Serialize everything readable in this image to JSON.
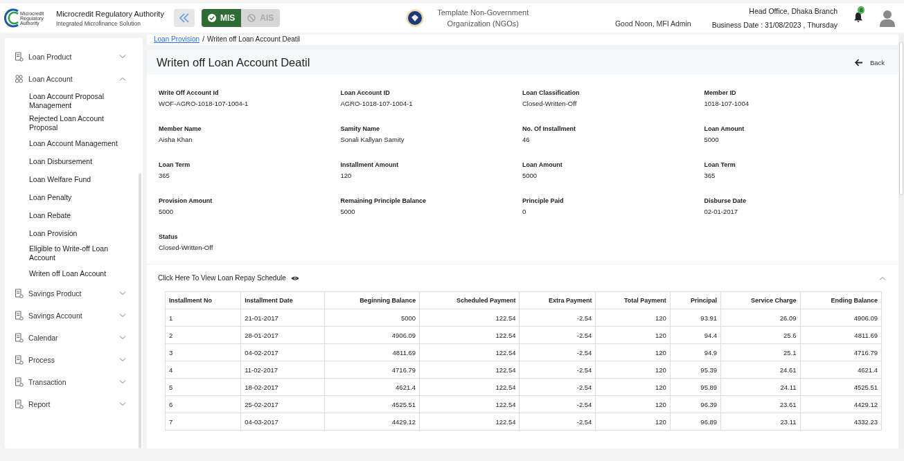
{
  "header": {
    "org_name": "Microcredit Regulatory Authority",
    "org_subtitle": "Integrated Microfinance Solution",
    "logo_text": "Microcredit Regulatory Authority",
    "modules": [
      {
        "label": "MIS",
        "selected": true
      },
      {
        "label": "AIS",
        "selected": false
      }
    ],
    "ngo_name": "Template Non-Government Organization (NGOs)",
    "greeting": "Good Noon, MFI Admin",
    "branch": "Head Office, Dhaka Branch",
    "business_date": "Business Date : 31/08/2023 , Thursday",
    "notification_count": "8"
  },
  "sidebar": {
    "items": [
      {
        "label": "Loan Product",
        "kind": "document",
        "expanded": false
      },
      {
        "label": "Loan Account",
        "kind": "people",
        "expanded": true,
        "children": [
          {
            "label": "Loan Account Proposal Management"
          },
          {
            "label": "Rejected Loan Account Proposal"
          },
          {
            "label": "Loan Account Management"
          },
          {
            "label": "Loan Disbursement"
          },
          {
            "label": "Loan Welfare Fund"
          },
          {
            "label": "Loan Penalty"
          },
          {
            "label": "Loan Rebate"
          },
          {
            "label": "Loan Provision"
          },
          {
            "label": "Eligible to Write-off Loan Account"
          },
          {
            "label": "Writen off Loan Account"
          }
        ]
      },
      {
        "label": "Savings Product",
        "kind": "document",
        "expanded": false
      },
      {
        "label": "Savings Account",
        "kind": "document",
        "expanded": false
      },
      {
        "label": "Calendar",
        "kind": "document",
        "expanded": false
      },
      {
        "label": "Process",
        "kind": "document",
        "expanded": false
      },
      {
        "label": "Transaction",
        "kind": "document",
        "expanded": false
      },
      {
        "label": "Report",
        "kind": "document",
        "expanded": false
      }
    ]
  },
  "breadcrumb": {
    "separator": "/",
    "items": [
      {
        "label": "Loan Provision",
        "kind": "link"
      },
      {
        "label": "Writen off Loan Account Deatil",
        "kind": "current"
      }
    ]
  },
  "detail": {
    "title": "Writen off Loan Account Deatil",
    "back_label": "Back",
    "fields": [
      {
        "label": "Write Off Account Id",
        "value": "WOF-AGRO-1018-107-1004-1"
      },
      {
        "label": "Loan Account ID",
        "value": "AGRO-1018-107-1004-1"
      },
      {
        "label": "Loan Classification",
        "value": "Closed-Written-Off"
      },
      {
        "label": "Member ID",
        "value": "1018-107-1004"
      },
      {
        "label": "Member Name",
        "value": "Aisha Khan"
      },
      {
        "label": "Samity Name",
        "value": "Sonali Kallyan Samity"
      },
      {
        "label": "No. Of Installment",
        "value": "46"
      },
      {
        "label": "Loan Amount",
        "value": "5000"
      },
      {
        "label": "Loan Term",
        "value": "365"
      },
      {
        "label": "Installment Amount",
        "value": "120"
      },
      {
        "label": "Loan Amount",
        "value": "5000"
      },
      {
        "label": "Loan Term",
        "value": "365"
      },
      {
        "label": "Provision Amount",
        "value": "5000"
      },
      {
        "label": "Remaining Principle Balance",
        "value": "5000"
      },
      {
        "label": "Principle Paid",
        "value": "0"
      },
      {
        "label": "Disburse Date",
        "value": "02-01-2017"
      },
      {
        "label": "Status",
        "value": "Closed-Written-Off"
      }
    ]
  },
  "schedule": {
    "toggle_label": "Click Here To View Loan Repay Schedule",
    "expanded": true,
    "columns": [
      {
        "label": "Installment No",
        "numeric": false
      },
      {
        "label": "Installment Date",
        "numeric": false
      },
      {
        "label": "Beginning Balance",
        "numeric": true
      },
      {
        "label": "Scheduled Payment",
        "numeric": true
      },
      {
        "label": "Extra Payment",
        "numeric": true
      },
      {
        "label": "Total Payment",
        "numeric": true
      },
      {
        "label": "Principal",
        "numeric": true
      },
      {
        "label": "Service Charge",
        "numeric": true
      },
      {
        "label": "Ending Balance",
        "numeric": true
      }
    ],
    "rows": [
      [
        "1",
        "21-01-2017",
        "5000",
        "122.54",
        "-2.54",
        "120",
        "93.91",
        "26.09",
        "4906.09"
      ],
      [
        "2",
        "28-01-2017",
        "4906.09",
        "122.54",
        "-2.54",
        "120",
        "94.4",
        "25.6",
        "4811.69"
      ],
      [
        "3",
        "04-02-2017",
        "4811.69",
        "122.54",
        "-2.54",
        "120",
        "94.9",
        "25.1",
        "4716.79"
      ],
      [
        "4",
        "11-02-2017",
        "4716.79",
        "122.54",
        "-2.54",
        "120",
        "95.39",
        "24.61",
        "4621.4"
      ],
      [
        "5",
        "18-02-2017",
        "4621.4",
        "122.54",
        "-2.54",
        "120",
        "95.89",
        "24.11",
        "4525.51"
      ],
      [
        "6",
        "25-02-2017",
        "4525.51",
        "122.54",
        "-2.54",
        "120",
        "96.39",
        "23.61",
        "4429.12"
      ],
      [
        "7",
        "04-03-2017",
        "4429.12",
        "122.54",
        "-2.54",
        "120",
        "96.89",
        "23.11",
        "4332.23"
      ]
    ]
  }
}
